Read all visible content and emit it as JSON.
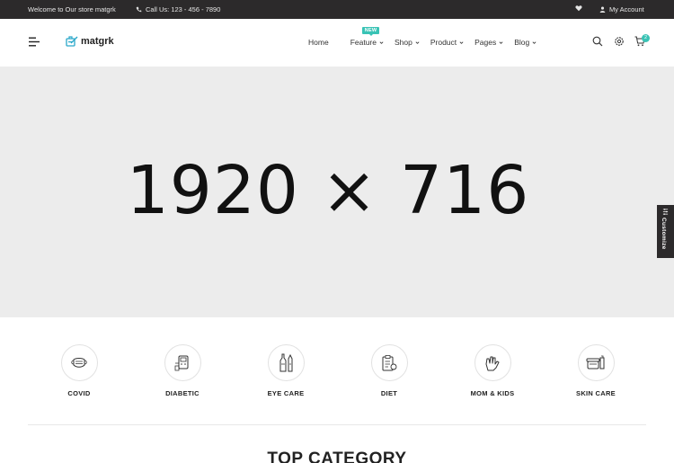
{
  "topbar": {
    "welcome": "Welcome to Our store matgrk",
    "phone": "Call Us: 123 - 456 - 7890",
    "account": "My Account"
  },
  "header": {
    "logo": "matgrk",
    "nav": [
      {
        "label": "Home",
        "dropdown": false
      },
      {
        "label": "Feature",
        "dropdown": true,
        "badge": "NEW"
      },
      {
        "label": "Shop",
        "dropdown": true
      },
      {
        "label": "Product",
        "dropdown": true
      },
      {
        "label": "Pages",
        "dropdown": true
      },
      {
        "label": "Blog",
        "dropdown": true
      }
    ],
    "cart_count": "2",
    "icons": [
      "search-icon",
      "settings-icon",
      "cart-icon"
    ]
  },
  "hero": {
    "placeholder": "1920 × 716"
  },
  "customize": {
    "label": "Customize"
  },
  "categories": [
    {
      "label": "COVID",
      "icon": "mask-icon"
    },
    {
      "label": "DIABETIC",
      "icon": "glucose-meter-icon"
    },
    {
      "label": "EYE CARE",
      "icon": "eye-drops-icon"
    },
    {
      "label": "DIET",
      "icon": "diet-plan-icon"
    },
    {
      "label": "MOM & KIDS",
      "icon": "hand-icon"
    },
    {
      "label": "SKIN CARE",
      "icon": "cream-jar-icon"
    }
  ],
  "section": {
    "title": "TOP CATEGORY"
  },
  "colors": {
    "accent": "#39c3b5",
    "topbar": "#2c2a2b",
    "hero": "#ececec"
  }
}
